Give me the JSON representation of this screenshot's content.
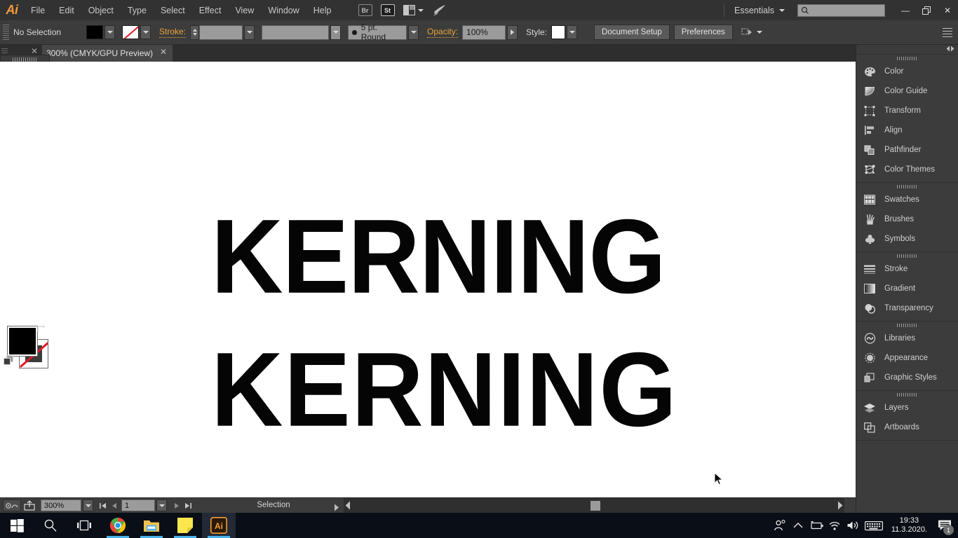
{
  "app": {
    "name": "Adobe Illustrator",
    "logo_text": "Ai"
  },
  "menubar": {
    "items": [
      {
        "label": "File"
      },
      {
        "label": "Edit"
      },
      {
        "label": "Object"
      },
      {
        "label": "Type"
      },
      {
        "label": "Select"
      },
      {
        "label": "Effect"
      },
      {
        "label": "View"
      },
      {
        "label": "Window"
      },
      {
        "label": "Help"
      }
    ],
    "bridge_label": "Br",
    "stock_label": "St",
    "workspace_label": "Essentials",
    "search_placeholder": "",
    "window_buttons": {
      "minimize": "—",
      "restore": "❐",
      "close": "✕"
    }
  },
  "controlbar": {
    "selection_status": "No Selection",
    "fill_color": "#000000",
    "stroke_color": "none",
    "stroke_label": "Stroke:",
    "stroke_weight": "",
    "stroke_profile": "",
    "brush_definition": "5 pt. Round",
    "opacity_label": "Opacity:",
    "opacity_value": "100%",
    "style_label": "Style:",
    "document_setup_label": "Document Setup",
    "preferences_label": "Preferences",
    "accent_color": "#e8a33d"
  },
  "tabbar": {
    "document_tab_label": "300%  (CMYK/GPU Preview)",
    "close_glyph": "✕"
  },
  "toolbar": {
    "tools": [
      [
        {
          "name": "selection-tool",
          "active": true
        },
        {
          "name": "direct-selection-tool",
          "active": false
        }
      ],
      [
        {
          "name": "magic-wand-tool",
          "active": false
        },
        {
          "name": "lasso-tool",
          "active": false
        }
      ],
      [
        {
          "name": "pen-tool",
          "active": false
        },
        {
          "name": "curvature-tool",
          "active": false
        }
      ],
      [
        {
          "name": "type-tool",
          "active": false
        },
        {
          "name": "line-segment-tool",
          "active": false
        }
      ],
      [
        {
          "name": "rectangle-tool",
          "active": false
        },
        {
          "name": "paintbrush-tool",
          "active": false
        }
      ],
      [
        {
          "name": "pencil-tool",
          "active": false
        },
        {
          "name": "eraser-tool",
          "active": false
        }
      ],
      [
        {
          "name": "rotate-tool",
          "active": false
        },
        {
          "name": "scale-tool",
          "active": false
        }
      ],
      [
        {
          "name": "width-tool",
          "active": false
        },
        {
          "name": "free-transform-tool",
          "active": false
        }
      ],
      [
        {
          "name": "shape-builder-tool",
          "active": false
        },
        {
          "name": "perspective-grid-tool",
          "active": false
        }
      ],
      [
        {
          "name": "mesh-tool",
          "active": false
        },
        {
          "name": "gradient-tool",
          "active": false
        }
      ],
      [
        {
          "name": "eyedropper-tool",
          "active": false
        },
        {
          "name": "blend-tool",
          "active": false
        }
      ],
      [
        {
          "name": "symbol-sprayer-tool",
          "active": false
        },
        {
          "name": "column-graph-tool",
          "active": false
        }
      ],
      [
        {
          "name": "artboard-tool",
          "active": false
        },
        {
          "name": "slice-tool",
          "active": false
        }
      ],
      [
        {
          "name": "hand-tool",
          "active": false
        },
        {
          "name": "zoom-tool",
          "active": false
        }
      ]
    ],
    "fill_color": "#000000",
    "stroke_color": "none"
  },
  "canvas": {
    "background": "#ffffff",
    "text_lines": [
      {
        "id": "line-1",
        "text": "KERNING",
        "note": "tight-kerning"
      },
      {
        "id": "line-2",
        "text": "KERNING",
        "note": "loose-kerning"
      }
    ]
  },
  "statusbar": {
    "zoom_value": "300%",
    "artboard_number": "1",
    "status_text": "Selection"
  },
  "dock": {
    "groups": [
      {
        "items": [
          {
            "label": "Color",
            "icon": "color-palette-icon"
          },
          {
            "label": "Color Guide",
            "icon": "color-guide-icon"
          },
          {
            "label": "Transform",
            "icon": "transform-icon"
          },
          {
            "label": "Align",
            "icon": "align-icon"
          },
          {
            "label": "Pathfinder",
            "icon": "pathfinder-icon"
          },
          {
            "label": "Color Themes",
            "icon": "color-themes-icon"
          }
        ]
      },
      {
        "items": [
          {
            "label": "Swatches",
            "icon": "swatches-icon"
          },
          {
            "label": "Brushes",
            "icon": "brushes-icon"
          },
          {
            "label": "Symbols",
            "icon": "symbols-icon"
          }
        ]
      },
      {
        "items": [
          {
            "label": "Stroke",
            "icon": "stroke-icon"
          },
          {
            "label": "Gradient",
            "icon": "gradient-icon"
          },
          {
            "label": "Transparency",
            "icon": "transparency-icon"
          }
        ]
      },
      {
        "items": [
          {
            "label": "Libraries",
            "icon": "libraries-icon"
          },
          {
            "label": "Appearance",
            "icon": "appearance-icon"
          },
          {
            "label": "Graphic Styles",
            "icon": "graphic-styles-icon"
          }
        ]
      },
      {
        "items": [
          {
            "label": "Layers",
            "icon": "layers-icon"
          },
          {
            "label": "Artboards",
            "icon": "artboards-icon"
          }
        ]
      }
    ]
  },
  "taskbar": {
    "items": [
      {
        "name": "start-button",
        "icon": "windows-logo-icon",
        "running": false
      },
      {
        "name": "search-button",
        "icon": "search-icon",
        "running": false
      },
      {
        "name": "task-view-button",
        "icon": "task-view-icon",
        "running": false
      },
      {
        "name": "chrome-button",
        "icon": "chrome-icon",
        "running": true
      },
      {
        "name": "file-explorer-button",
        "icon": "folder-icon",
        "running": true
      },
      {
        "name": "sticky-notes-button",
        "icon": "sticky-note-icon",
        "running": true
      },
      {
        "name": "illustrator-button",
        "icon": "illustrator-icon",
        "running": true
      }
    ],
    "tray": {
      "icons": [
        "people-icon",
        "show-hidden-icons-chevron",
        "battery-icon",
        "wifi-icon",
        "volume-icon",
        "keyboard-icon"
      ]
    },
    "clock": {
      "time": "19:33",
      "date": "11.3.2020."
    },
    "notification_count": "1"
  }
}
